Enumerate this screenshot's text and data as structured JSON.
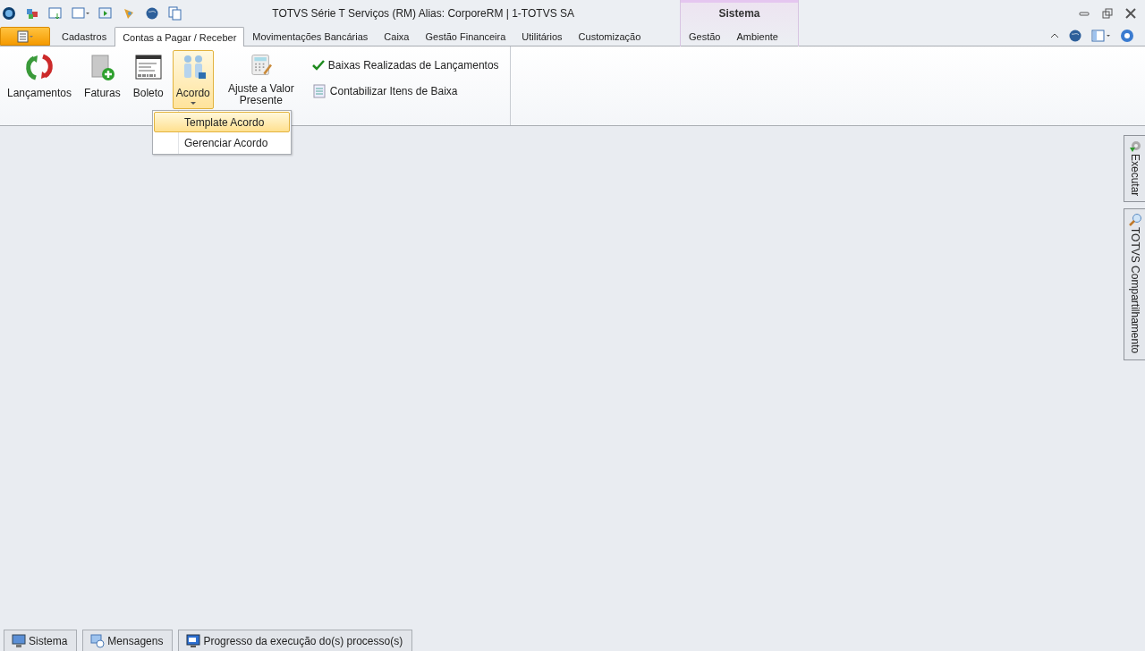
{
  "window": {
    "title": "TOTVS Série T Serviços (RM) Alias:  CorporeRM | 1-TOTVS SA"
  },
  "tabs": [
    {
      "label": "Cadastros",
      "selected": false
    },
    {
      "label": "Contas a Pagar / Receber",
      "selected": true
    },
    {
      "label": "Movimentações Bancárias",
      "selected": false
    },
    {
      "label": "Caixa",
      "selected": false
    },
    {
      "label": "Gestão Financeira",
      "selected": false
    },
    {
      "label": "Utilitários",
      "selected": false
    },
    {
      "label": "Customização",
      "selected": false
    }
  ],
  "context_group": {
    "label": "Sistema",
    "tabs": [
      {
        "label": "Gestão",
        "selected": false
      },
      {
        "label": "Ambiente",
        "selected": false
      }
    ]
  },
  "ribbon": {
    "large_buttons": [
      {
        "label": "Lançamentos",
        "kind": "cycle",
        "open": false,
        "dropdown": false
      },
      {
        "label": "Faturas",
        "kind": "document",
        "open": false,
        "dropdown": false
      },
      {
        "label": "Boleto",
        "kind": "barcode",
        "open": false,
        "dropdown": false
      },
      {
        "label": "Acordo",
        "kind": "people",
        "open": true,
        "dropdown": true
      },
      {
        "label": "Ajuste a Valor Presente",
        "kind": "calculator",
        "open": false,
        "dropdown": false
      }
    ],
    "small_buttons": [
      {
        "label": "Baixas Realizadas de Lançamentos",
        "kind": "check"
      },
      {
        "label": "Contabilizar Itens de Baixa",
        "kind": "list"
      }
    ]
  },
  "dropdown_menu": [
    {
      "label": "Template Acordo",
      "selected": true
    },
    {
      "label": "Gerenciar Acordo",
      "selected": false
    }
  ],
  "side_tabs": [
    {
      "label": "Executar",
      "kind": "gear"
    },
    {
      "label": "TOTVS Compartilhamento",
      "kind": "search"
    }
  ],
  "status_bar": [
    {
      "label": "Sistema",
      "kind": "monitor"
    },
    {
      "label": "Mensagens",
      "kind": "messages"
    },
    {
      "label": "Progresso da execução do(s) processo(s)",
      "kind": "progress"
    }
  ]
}
